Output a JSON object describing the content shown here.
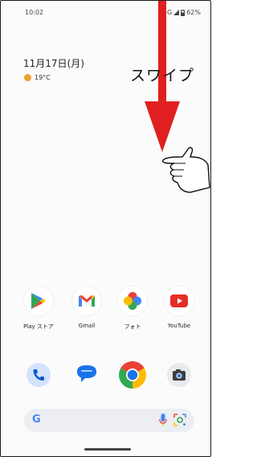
{
  "status_bar": {
    "time": "10:02",
    "signal": "5G",
    "battery": "62%"
  },
  "widget": {
    "date": "11月17日(月)",
    "temperature": "19°C"
  },
  "annotation": {
    "text": "スワイプ"
  },
  "apps": [
    {
      "label": "Play ストア",
      "icon": "play-store-icon"
    },
    {
      "label": "Gmail",
      "icon": "gmail-icon"
    },
    {
      "label": "フォト",
      "icon": "photos-icon"
    },
    {
      "label": "YouTube",
      "icon": "youtube-icon"
    }
  ],
  "dock": [
    {
      "icon": "phone-icon"
    },
    {
      "icon": "messages-icon"
    },
    {
      "icon": "chrome-icon"
    },
    {
      "icon": "camera-icon"
    }
  ],
  "search": {
    "logo": "G"
  }
}
